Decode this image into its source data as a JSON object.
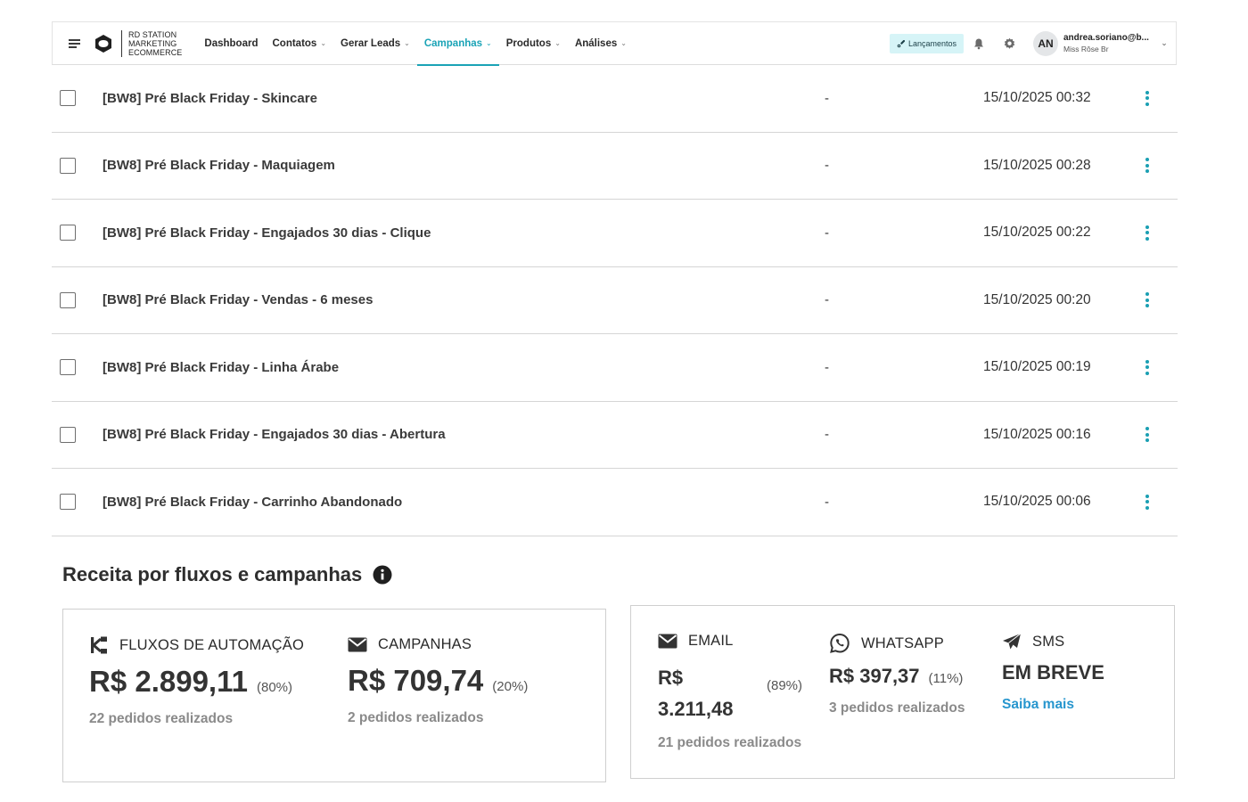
{
  "brand": {
    "line1": "RD STATION",
    "line2": "MARKETING",
    "line3": "ECOMMERCE"
  },
  "nav": {
    "items": [
      {
        "label": "Dashboard",
        "has_dropdown": false,
        "active": false
      },
      {
        "label": "Contatos",
        "has_dropdown": true,
        "active": false
      },
      {
        "label": "Gerar Leads",
        "has_dropdown": true,
        "active": false
      },
      {
        "label": "Campanhas",
        "has_dropdown": true,
        "active": true
      },
      {
        "label": "Produtos",
        "has_dropdown": true,
        "active": false
      },
      {
        "label": "Análises",
        "has_dropdown": true,
        "active": false
      }
    ],
    "launch_button": "Lançamentos",
    "notification_icon": "bell-icon",
    "settings_icon": "gear-icon"
  },
  "user": {
    "initials": "AN",
    "email": "andrea.soriano@b...",
    "account": "Miss Rôse Br"
  },
  "campaigns": {
    "rows": [
      {
        "name": "[BW8] Pré Black Friday - Skincare",
        "value": "-",
        "date": "15/10/2025 00:32"
      },
      {
        "name": "[BW8] Pré Black Friday - Maquiagem",
        "value": "-",
        "date": "15/10/2025 00:28"
      },
      {
        "name": "[BW8] Pré Black Friday - Engajados 30 dias - Clique",
        "value": "-",
        "date": "15/10/2025 00:22"
      },
      {
        "name": "[BW8] Pré Black Friday - Vendas - 6 meses",
        "value": "-",
        "date": "15/10/2025 00:20"
      },
      {
        "name": "[BW8] Pré Black Friday - Linha Árabe",
        "value": "-",
        "date": "15/10/2025 00:19"
      },
      {
        "name": "[BW8] Pré Black Friday - Engajados 30 dias - Abertura",
        "value": "-",
        "date": "15/10/2025 00:16"
      },
      {
        "name": "[BW8] Pré Black Friday - Carrinho Abandonado",
        "value": "-",
        "date": "15/10/2025 00:06"
      }
    ]
  },
  "revenue": {
    "title": "Receita por fluxos e campanhas",
    "flows": {
      "label": "FLUXOS DE AUTOMAÇÃO",
      "value": "R$ 2.899,11",
      "percent": "(80%)",
      "orders": "22 pedidos realizados"
    },
    "campaigns": {
      "label": "CAMPANHAS",
      "value": "R$ 709,74",
      "percent": "(20%)",
      "orders": "2 pedidos realizados"
    },
    "email": {
      "label": "EMAIL",
      "value_line1": "R$",
      "value_line2": "3.211,48",
      "percent": "(89%)",
      "orders": "21 pedidos realizados"
    },
    "whatsapp": {
      "label": "WHATSAPP",
      "value": "R$ 397,37",
      "percent": "(11%)",
      "orders": "3 pedidos realizados"
    },
    "sms": {
      "label": "SMS",
      "value": "EM BREVE",
      "link": "Saiba mais"
    }
  },
  "colors": {
    "accent": "#1aa3b6",
    "link": "#2796ce",
    "launch_bg": "#d6f4f7"
  }
}
